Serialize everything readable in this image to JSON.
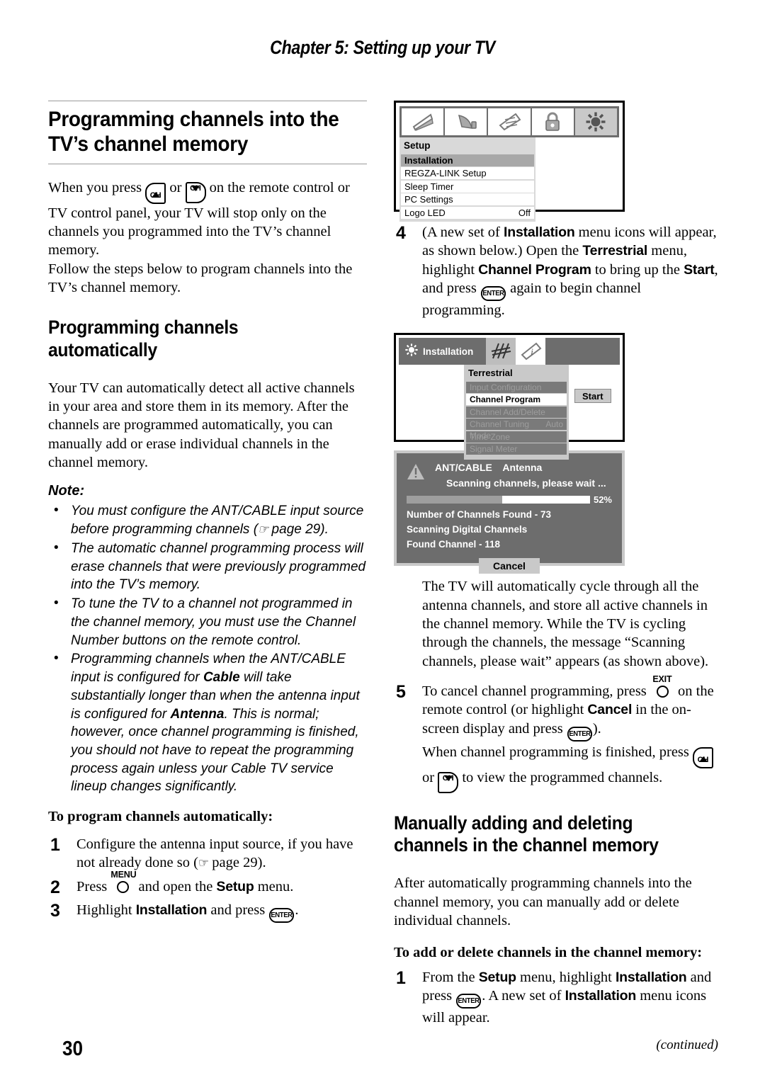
{
  "header": {
    "chapter": "Chapter 5: Setting up your TV"
  },
  "page": {
    "number": "30",
    "continued": "(continued)"
  },
  "left": {
    "h1": "Programming channels into the TV’s channel memory",
    "intro_p1_a": "When you press ",
    "intro_p1_b": " or ",
    "intro_p1_c": " on the remote control or TV control panel, your TV will stop only on the channels you programmed into the TV’s channel memory.",
    "intro_p2": "Follow the steps below to program channels into the TV’s channel memory.",
    "h2_auto": "Programming channels automatically",
    "auto_p": "Your TV can automatically detect all active channels in your area and store them in its memory. After the channels are programmed automatically, you can manually add or erase individual channels in the channel memory.",
    "note_label": "Note:",
    "notes": [
      {
        "pre": "You must configure the ANT/CABLE input source before programming channels (",
        "post": " page 29)."
      },
      {
        "pre": "The automatic channel programming process will erase channels that were previously programmed into the TV’s memory.",
        "post": ""
      },
      {
        "pre": "To tune the TV to a channel not programmed in the channel memory, you must use the Channel Number buttons on the remote control.",
        "post": ""
      }
    ],
    "note4": {
      "a": "Programming channels when the ANT/CABLE input is configured for ",
      "b": "Cable",
      "c": " will take substantially longer than when the antenna input is configured for ",
      "d": "Antenna",
      "e": ". This is normal; however, once channel programming is finished, you should not have to repeat the programming process again unless your Cable TV service lineup changes significantly."
    },
    "h3_steps": "To program channels automatically:",
    "step1": {
      "num": "1",
      "a": "Configure the antenna input source, if you have not already done so (",
      "b": " page 29)."
    },
    "step2": {
      "num": "2",
      "a": "Press ",
      "key": "MENU",
      "b": " and open the ",
      "bold": "Setup",
      "c": " menu."
    },
    "step3": {
      "num": "3",
      "a": "Highlight ",
      "bold": "Installation",
      "b": " and press ",
      "c": "."
    }
  },
  "osd_setup": {
    "icons": [
      "picture-icon",
      "sound-icon",
      "preferences-icon",
      "lock-icon",
      "setup-sun-icon"
    ],
    "selected_icon_index": 4,
    "title": "Setup",
    "rows": [
      {
        "label": "Installation",
        "value": "",
        "highlighted": true
      },
      {
        "label": "REGZA-LINK Setup",
        "value": "",
        "highlighted": false
      },
      {
        "label": "Sleep Timer",
        "value": "",
        "highlighted": false
      },
      {
        "label": "PC Settings",
        "value": "",
        "highlighted": false
      },
      {
        "label": "Logo LED",
        "value": "Off",
        "highlighted": false
      }
    ]
  },
  "right": {
    "step4": {
      "num": "4",
      "a": "(A new set of ",
      "b": "Installation",
      "c": " menu icons will appear, as shown below.) Open the ",
      "d": "Terrestrial",
      "e": " menu, highlight ",
      "f": "Channel Program",
      "g": " to bring up the ",
      "h": "Start",
      "i": ", and press ",
      "j": " again to begin channel programming."
    },
    "para_cycle": "The TV will automatically cycle through all the antenna channels, and store all active channels in the channel memory. While the TV is cycling through the channels, the message “Scanning channels, please wait” appears (as shown above).",
    "step5": {
      "num": "5",
      "a": "To cancel channel programming, press ",
      "key": "EXIT",
      "b": " on the remote control (or highlight ",
      "c": "Cancel",
      "d": " in the on-screen display and press ",
      "e": ").",
      "f": "When channel programming is finished, press ",
      "g": " or ",
      "h": " to view the programmed channels."
    },
    "h2_manual": "Manually adding and deleting channels in the channel memory",
    "manual_p": "After automatically programming channels into the channel memory, you can manually add or delete individual channels.",
    "h3_manual": "To add or delete channels in the channel memory:",
    "mstep1": {
      "num": "1",
      "a": "From the ",
      "b": "Setup",
      "c": " menu, highlight ",
      "d": "Installation",
      "e": " and press ",
      "f": ". A new set of ",
      "g": "Installation",
      "h": " menu icons will appear."
    }
  },
  "osd_installation": {
    "title": "Installation",
    "icons": [
      "antenna-icon",
      "info-icon"
    ],
    "selected_icon_index": 0,
    "panel_title": "Terrestrial",
    "rows": [
      {
        "label": "Input Configuration",
        "value": "",
        "selected": false
      },
      {
        "label": "Channel Program",
        "value": "",
        "selected": true
      },
      {
        "label": "Channel Add/Delete",
        "value": "",
        "selected": false
      },
      {
        "label": "Channel Tuning Mode",
        "value": "Auto",
        "selected": false
      },
      {
        "label": "Time Zone",
        "value": "",
        "selected": false
      },
      {
        "label": "Signal Meter",
        "value": "",
        "selected": false
      }
    ],
    "start_button": "Start"
  },
  "osd_scanning": {
    "source_label": "ANT/CABLE",
    "source_value": "Antenna",
    "status": "Scanning channels, please wait ...",
    "progress_percent": "52%",
    "progress_value": 52,
    "line1": "Number of Channels Found - 73",
    "line2": "Scanning Digital Channels",
    "line3": "Found Channel - 118",
    "cancel_button": "Cancel"
  },
  "colors": {
    "osd_panel_light": "#d9d9d9",
    "osd_highlight": "#a8a8a8",
    "osd_dark": "#6d6d6d",
    "osd_border": "#c9c9c9",
    "rule": "#9a9a9a"
  }
}
